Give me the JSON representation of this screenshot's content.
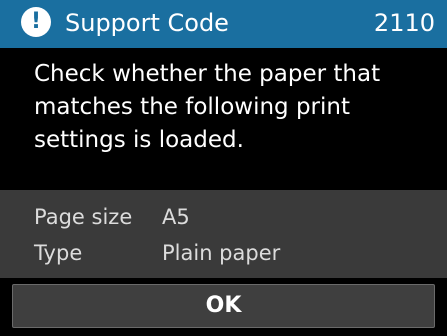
{
  "header": {
    "icon": "alert-icon",
    "title": "Support Code",
    "code": "2110",
    "color": "#1a6fa0"
  },
  "message": {
    "line1": "Check whether the paper that",
    "line2": "matches the following print",
    "line3": "settings is loaded."
  },
  "settings": [
    {
      "label": "Page size",
      "value": "A5"
    },
    {
      "label": "Type",
      "value": "Plain paper"
    }
  ],
  "buttons": {
    "ok_label": "OK"
  }
}
